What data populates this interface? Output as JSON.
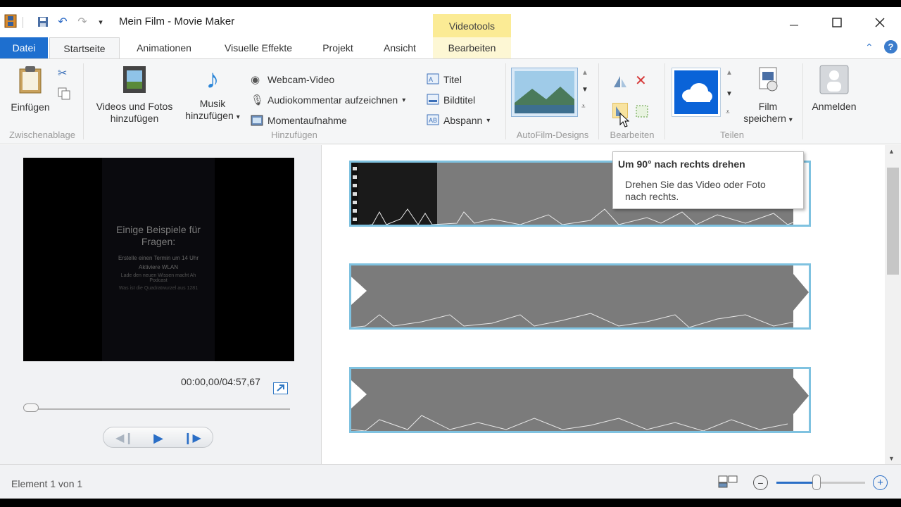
{
  "title": "Mein Film - Movie Maker",
  "contextual_tab": "Videotools",
  "tabs": {
    "file": "Datei",
    "home": "Startseite",
    "animations": "Animationen",
    "visual_effects": "Visuelle Effekte",
    "project": "Projekt",
    "view": "Ansicht",
    "edit": "Bearbeiten"
  },
  "ribbon": {
    "paste": "Einfügen",
    "clipboard_group": "Zwischenablage",
    "add_videos_l1": "Videos und Fotos",
    "add_videos_l2": "hinzufügen",
    "add_music_l1": "Musik",
    "add_music_l2": "hinzufügen",
    "webcam": "Webcam-Video",
    "narration": "Audiokommentar aufzeichnen",
    "snapshot": "Momentaufnahme",
    "title": "Titel",
    "caption": "Bildtitel",
    "credits": "Abspann",
    "add_group": "Hinzufügen",
    "autofilm_group": "AutoFilm-Designs",
    "edit_group": "Bearbeiten",
    "save_movie_l1": "Film",
    "save_movie_l2": "speichern",
    "share_group": "Teilen",
    "sign_in": "Anmelden"
  },
  "preview": {
    "timecode": "00:00,00/04:57,67",
    "screen_heading": "Einige Beispiele für Fragen:",
    "screen_line1": "Erstelle einen Termin um 14 Uhr",
    "screen_line2": "Aktiviere WLAN",
    "screen_line3": "Lade den neuen Wissen macht Ah Podcast",
    "screen_line4": "Was ist die Quadratwurzel aus 1281",
    "progress": 0
  },
  "tooltip": {
    "title": "Um 90° nach rechts drehen",
    "body": "Drehen Sie das Video oder Foto nach rechts."
  },
  "status": {
    "text": "Element 1 von 1",
    "zoom_level": 0.45
  },
  "colors": {
    "file_tab": "#1e6fcf",
    "contextual": "#fbeb95",
    "clip_border": "#7fc2e0"
  }
}
